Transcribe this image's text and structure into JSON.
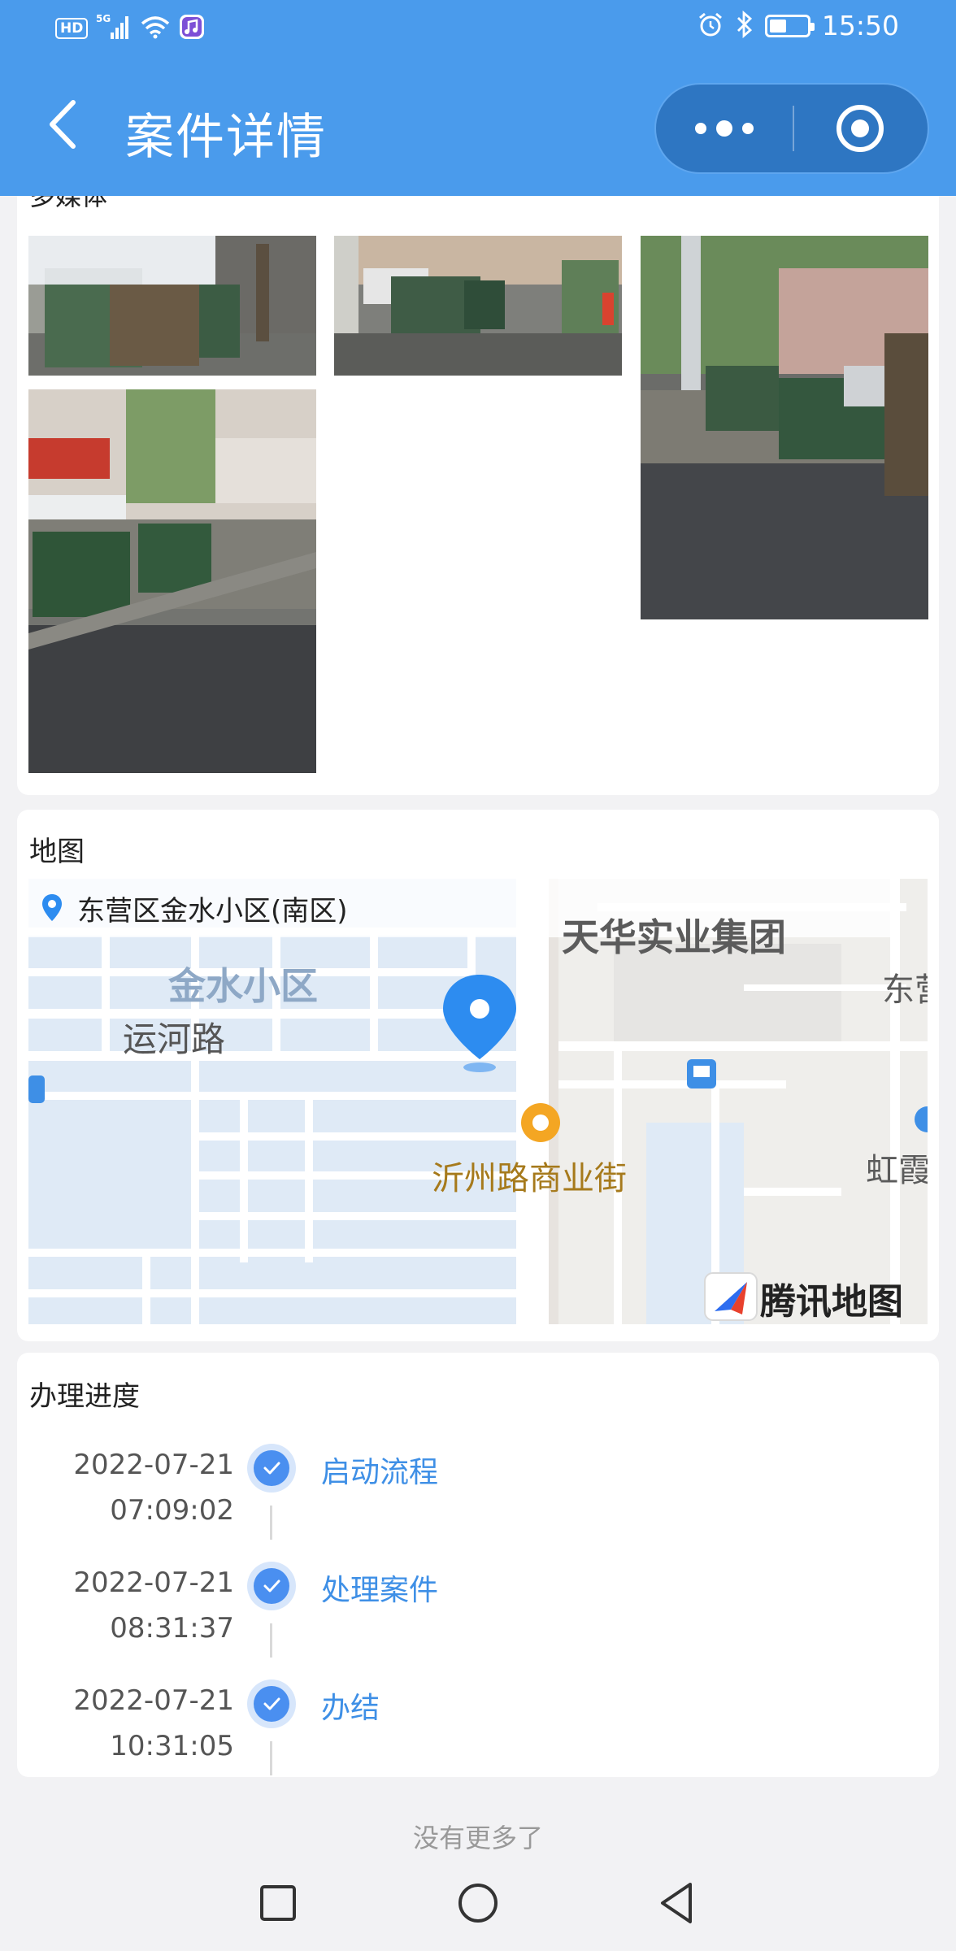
{
  "status_bar": {
    "network_badge": "HD",
    "signal": "5G",
    "time": "15:50",
    "icons": [
      "signal-icon",
      "wifi-icon",
      "music-app-icon",
      "alarm-icon",
      "bluetooth-icon",
      "battery-icon"
    ]
  },
  "header": {
    "title": "案件详情",
    "back_icon": "chevron-left-icon",
    "more_icon": "more-dots-icon",
    "close_icon": "target-circle-icon",
    "background_color": "#4a9bec"
  },
  "media": {
    "label": "多媒体",
    "photos": [
      {
        "subject": "garbage-bins-street-1"
      },
      {
        "subject": "garbage-bins-street-2"
      },
      {
        "subject": "garbage-bins-street-3"
      },
      {
        "subject": "garbage-bins-street-4"
      }
    ]
  },
  "map": {
    "section_title": "地图",
    "address": "东营区金水小区(南区)",
    "labels": {
      "tianhua": "天华实业集团",
      "jinshui": "金水小区",
      "yunhe": "运河路",
      "yizhou": "沂州路商业街",
      "dong": "东营",
      "hongxia": "虹霞",
      "provider": "腾讯地图"
    }
  },
  "progress": {
    "section_title": "办理进度",
    "steps": [
      {
        "date": "2022-07-21",
        "time": "07:09:02",
        "label": "启动流程"
      },
      {
        "date": "2022-07-21",
        "time": "08:31:37",
        "label": "处理案件"
      },
      {
        "date": "2022-07-21",
        "time": "10:31:05",
        "label": "办结"
      }
    ]
  },
  "footer": {
    "no_more": "没有更多了"
  },
  "system_nav": {
    "icons": [
      "recent-apps-icon",
      "home-icon",
      "back-icon"
    ]
  }
}
